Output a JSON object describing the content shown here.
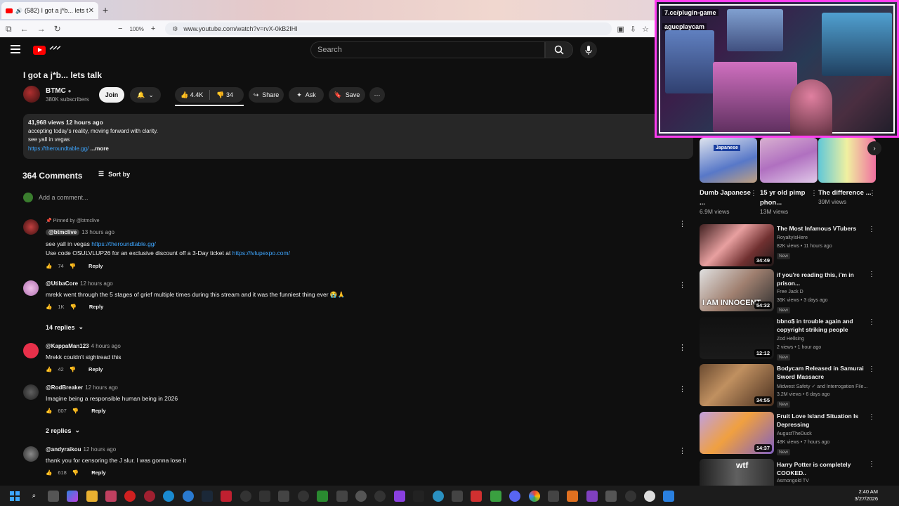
{
  "browser": {
    "tab_title": "(582) I got a j*b... lets talk",
    "url": "www.youtube.com/watch?v=rvX-0kB2IHI",
    "zoom": "100%"
  },
  "youtube": {
    "search_placeholder": "Search"
  },
  "video": {
    "title": "I got a j*b... lets talk",
    "channel": "BTMC",
    "subscribers": "380K subscribers",
    "join_label": "Join",
    "likes": "4.4K",
    "dislikes": "34",
    "share_label": "Share",
    "ask_label": "Ask",
    "save_label": "Save"
  },
  "description": {
    "meta": "41,968 views  12 hours ago",
    "line1": "accepting today's reality, moving forward with clarity.",
    "line2": "see yall in vegas",
    "link": "https://theroundtable.gg/",
    "more": "...more"
  },
  "comments_section": {
    "count": "364 Comments",
    "sort_label": "Sort by",
    "add_placeholder": "Add a comment...",
    "reply_label": "Reply",
    "comments": [
      {
        "pinned": "Pinned by @btmclive",
        "author": "@btmclive",
        "time": "13 hours ago",
        "line1_text": "see yall in vegas ",
        "line1_link": "https://theroundtable.gg/",
        "line2_text": "Use code OSULVLUP26 for an exclusive discount off a 3-Day ticket at ",
        "line2_link": "https://lvlupexpo.com/",
        "likes": "74"
      },
      {
        "author": "@UtibaCore",
        "time": "12 hours ago",
        "text": "mrekk went through the 5 stages of grief multiple times during this stream and it was the funniest thing ever 😭🙏",
        "likes": "1K",
        "replies": "14 replies"
      },
      {
        "author": "@KappaMan123",
        "time": "4 hours ago",
        "text": "Mrekk couldn't sightread this",
        "likes": "42"
      },
      {
        "author": "@RodBreaker",
        "time": "12 hours ago",
        "text": "Imagine being a responsible human being in 2026",
        "likes": "607",
        "replies": "2 replies"
      },
      {
        "author": "@andyraikou",
        "time": "12 hours ago",
        "text": "thank you for censoring the J slur. I was gonna lose it",
        "likes": "618"
      }
    ]
  },
  "shorts": [
    {
      "title": "Dumb Japanese ...",
      "views": "6.9M views",
      "badge": "Japanese"
    },
    {
      "title": "15 yr old pimp phon...",
      "views": "13M views"
    },
    {
      "title": "The difference ...",
      "views": "39M views"
    }
  ],
  "recommendations": [
    {
      "title": "The Most Infamous VTubers",
      "channel": "RoyaltyIsHere",
      "views": "82K views • 11 hours ago",
      "duration": "34:49",
      "badge": "New"
    },
    {
      "title": "if you're reading this, i'm in prison...",
      "channel": "Free Jack D",
      "views": "36K views • 3 days ago",
      "duration": "54:32",
      "badge": "New",
      "thumb_text": "I AM INNOCENT"
    },
    {
      "title": "bbno$ in trouble again and copyright striking people",
      "channel": "Zod Hellsing",
      "views": "2 views • 1 hour ago",
      "duration": "12:12",
      "badge": "New"
    },
    {
      "title": "Bodycam Released in Samurai Sword Massacre",
      "channel": "Midwest Safety ✓ and Interrogation File...",
      "views": "3.2M views • 6 days ago",
      "duration": "34:55",
      "badge": "New"
    },
    {
      "title": "Fruit Love Island Situation Is Depressing",
      "channel": "AugustTheDuck",
      "views": "48K views • 7 hours ago",
      "duration": "14:37",
      "badge": "New"
    },
    {
      "title": "Harry Potter is completely COOKED..",
      "channel": "Asmongold TV",
      "thumb_text": "wtf"
    }
  ],
  "overlay": {
    "line1": "7.ce/plugin-game",
    "line2": "agueplaycam"
  },
  "taskbar": {
    "time": "2:40 AM",
    "date": "3/27/2026"
  }
}
